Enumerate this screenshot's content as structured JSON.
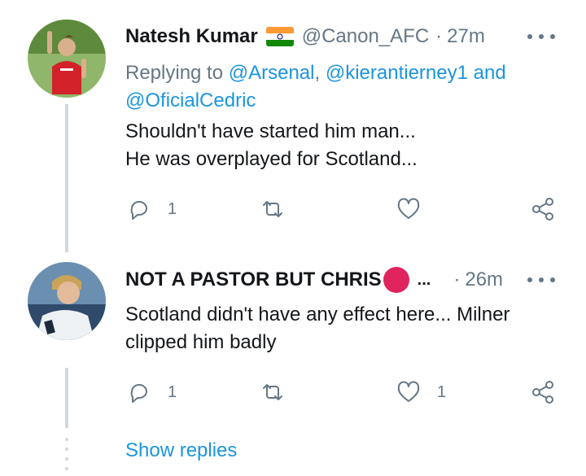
{
  "tweets": [
    {
      "name": "Natesh Kumar",
      "flag_icon": "india-flag-icon",
      "handle": "@Canon_AFC",
      "dot": "·",
      "time": "27m",
      "replying_prefix": "Replying to ",
      "replying_user1": "@Arsenal",
      "replying_sep": ", ",
      "replying_user2": "@kierantierney1",
      "replying_and": " and",
      "replying_user3": "@OficialCedric",
      "text": "Shouldn't have started him man...\nHe was overplayed for Scotland...",
      "reply_count": "1",
      "retweet_count": "",
      "like_count": ""
    },
    {
      "name": "NOT A PASTOR BUT CHRIS",
      "emoji_icon": "red-circle-icon",
      "ellipsis": "...",
      "dot": "·",
      "time": "26m",
      "text": "Scotland didn't have any effect here... Milner\nclipped him badly",
      "reply_count": "1",
      "retweet_count": "",
      "like_count": "1"
    }
  ],
  "show_replies": "Show replies",
  "colors": {
    "link": "#1b95e0",
    "secondary": "#657786",
    "thread_line": "#cfd9de",
    "red_circle": "#e0245e"
  }
}
